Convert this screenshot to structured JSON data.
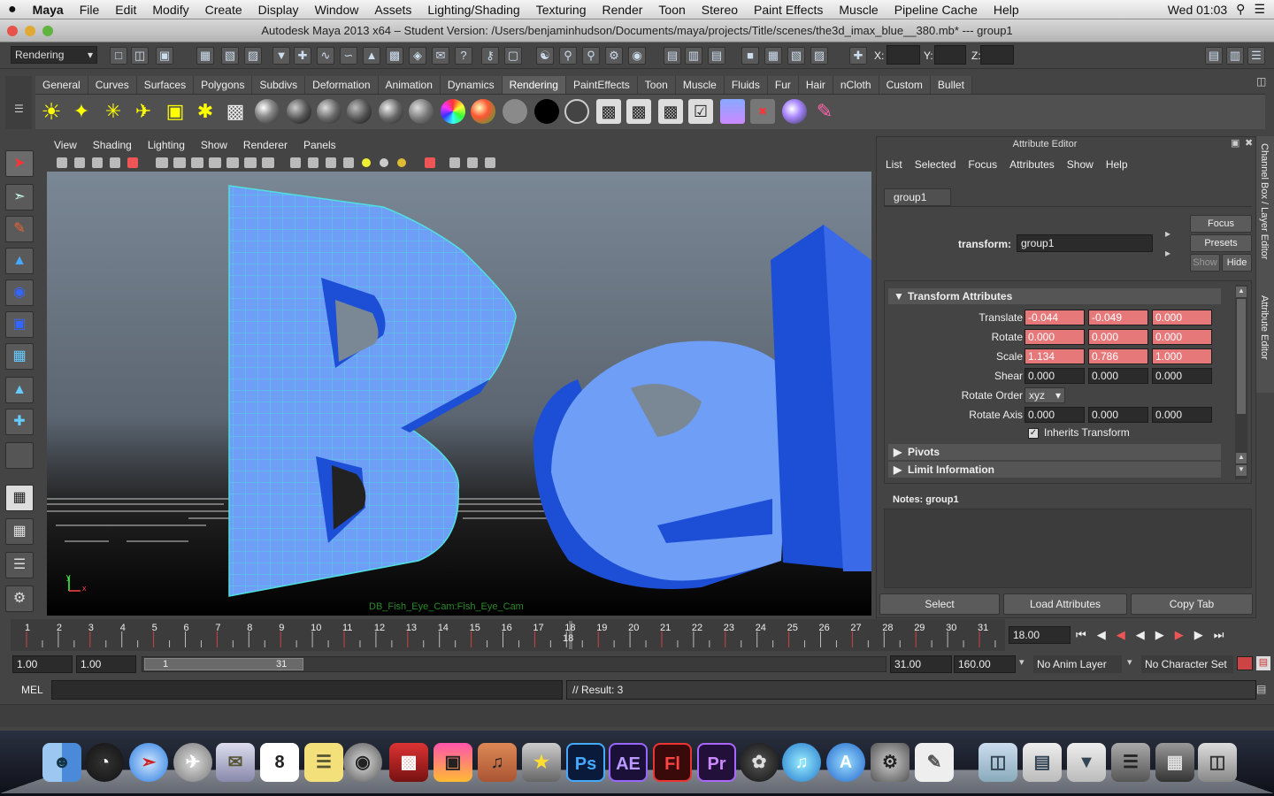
{
  "menubar": {
    "apple": "",
    "items": [
      "Maya",
      "File",
      "Edit",
      "Modify",
      "Create",
      "Display",
      "Window",
      "Assets",
      "Lighting/Shading",
      "Texturing",
      "Render",
      "Toon",
      "Stereo",
      "Paint Effects",
      "Muscle",
      "Pipeline Cache",
      "Help"
    ],
    "clock": "Wed 01:03"
  },
  "window": {
    "title": "Autodesk Maya 2013 x64 – Student Version: /Users/benjaminhudson/Documents/maya/projects/Title/scenes/the3d_imax_blue__380.mb*  ---   group1"
  },
  "statusline": {
    "menuset": "Rendering",
    "x_label": "X:",
    "y_label": "Y:",
    "z_label": "Z:"
  },
  "shelf": {
    "tabs": [
      "General",
      "Curves",
      "Surfaces",
      "Polygons",
      "Subdivs",
      "Deformation",
      "Animation",
      "Dynamics",
      "Rendering",
      "PaintEffects",
      "Toon",
      "Muscle",
      "Fluids",
      "Fur",
      "Hair",
      "nCloth",
      "Custom",
      "Bullet"
    ],
    "active": "Rendering"
  },
  "viewport": {
    "menu": [
      "View",
      "Shading",
      "Lighting",
      "Show",
      "Renderer",
      "Panels"
    ],
    "camera_label": "DB_Fish_Eye_Cam:Fish_Eye_Cam",
    "axis_x": "x",
    "axis_y": "y",
    "letters": [
      "B",
      "e",
      "l"
    ]
  },
  "attribute_editor": {
    "title": "Attribute Editor",
    "menu": [
      "List",
      "Selected",
      "Focus",
      "Attributes",
      "Show",
      "Help"
    ],
    "node_tab": "group1",
    "transform_label": "transform:",
    "transform_value": "group1",
    "buttons": {
      "focus": "Focus",
      "presets": "Presets",
      "show": "Show",
      "hide": "Hide"
    },
    "section_transform": "Transform Attributes",
    "translate_label": "Translate",
    "translate": [
      "-0.044",
      "-0.049",
      "0.000"
    ],
    "rotate_label": "Rotate",
    "rotate": [
      "0.000",
      "0.000",
      "0.000"
    ],
    "scale_label": "Scale",
    "scale": [
      "1.134",
      "0.786",
      "1.000"
    ],
    "shear_label": "Shear",
    "shear": [
      "0.000",
      "0.000",
      "0.000"
    ],
    "rotate_order_label": "Rotate Order",
    "rotate_order": "xyz",
    "rotate_axis_label": "Rotate Axis",
    "rotate_axis": [
      "0.000",
      "0.000",
      "0.000"
    ],
    "inherits_label": "Inherits Transform",
    "section_pivots": "Pivots",
    "section_limit": "Limit Information",
    "notes_label": "Notes:  group1",
    "bottom_buttons": [
      "Select",
      "Load Attributes",
      "Copy Tab"
    ],
    "side_tab_channel": "Channel Box / Layer Editor",
    "side_tab_attr": "Attribute Editor"
  },
  "timeline": {
    "ticks": [
      "1",
      "2",
      "3",
      "4",
      "5",
      "6",
      "7",
      "8",
      "9",
      "10",
      "11",
      "12",
      "13",
      "14",
      "15",
      "16",
      "17",
      "18",
      "19",
      "20",
      "21",
      "22",
      "23",
      "24",
      "25",
      "26",
      "27",
      "28",
      "29",
      "30",
      "31"
    ],
    "current_frame_marker": "18",
    "current_frame": "18.00"
  },
  "range": {
    "start": "1.00",
    "playback_start": "1.00",
    "slider_start": "1",
    "slider_end": "31",
    "playback_end": "31.00",
    "end": "160.00",
    "anim_layer": "No Anim Layer",
    "character_set": "No Character Set"
  },
  "cmdline": {
    "lang": "MEL",
    "result": "// Result: 3"
  },
  "colors": {
    "letter_face": "#6e9ef5",
    "letter_side": "#1d4fd6",
    "wire": "#4fe0e0",
    "error_field": "#e7787a"
  },
  "dock": {
    "apps": [
      "finder",
      "dashboard",
      "safari",
      "launchpad",
      "mail",
      "calendar",
      "stickies",
      "facetime",
      "photo-booth",
      "iphoto",
      "garageband",
      "imovie",
      "photoshop",
      "after-effects",
      "flash",
      "premiere",
      "maya",
      "itunes",
      "app-store",
      "system-preferences",
      "textedit",
      "applications-folder",
      "documents-folder",
      "downloads-folder",
      "stack-folder",
      "trash"
    ],
    "ps_label": "Ps",
    "ae_label": "AE",
    "fl_label": "Fl",
    "pr_label": "Pr"
  }
}
